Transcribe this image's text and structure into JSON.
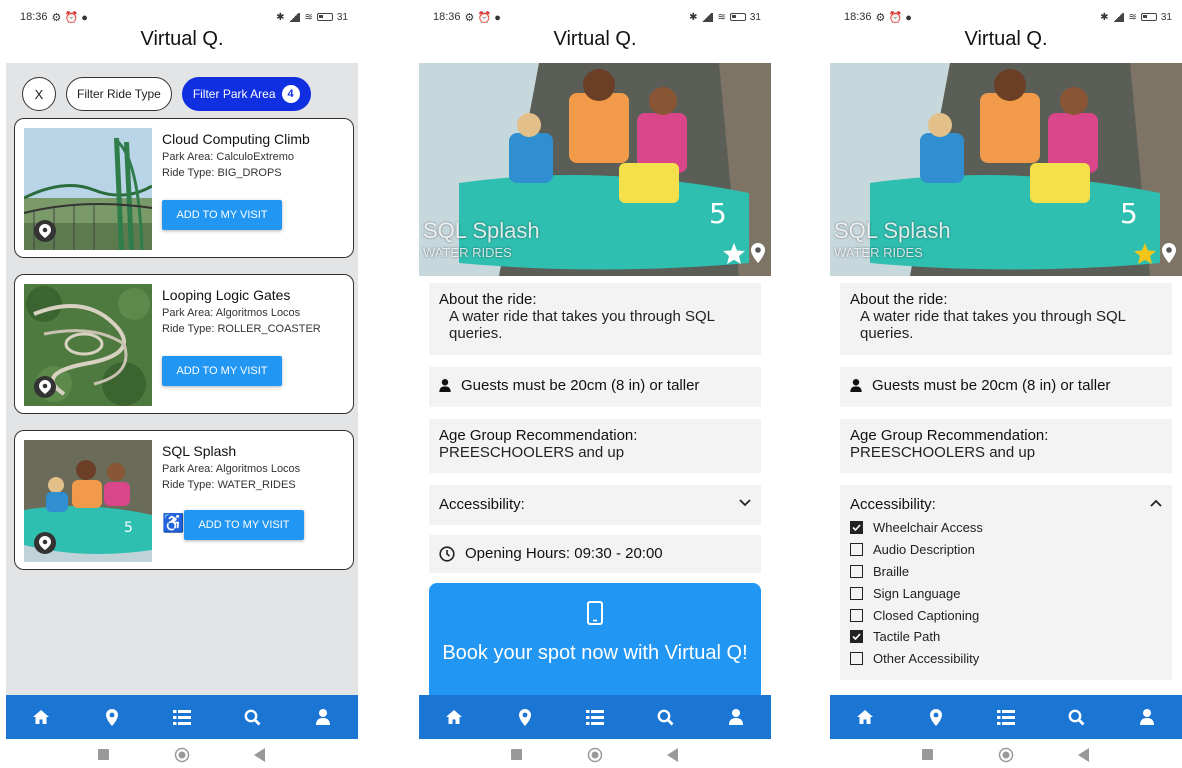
{
  "status": {
    "time": "18:36",
    "battery": "31"
  },
  "app_title": "Virtual Q.",
  "list_screen": {
    "filters": {
      "clear_label": "X",
      "ride_type_label": "Filter Ride Type",
      "park_area_label": "Filter Park Area",
      "park_area_count": "4"
    },
    "rides": [
      {
        "name": "Cloud Computing Climb",
        "park_area": "Park Area: CalculoExtremo",
        "ride_type": "Ride Type: BIG_DROPS",
        "button": "ADD TO MY VISIT",
        "wheelchair": false
      },
      {
        "name": "Looping Logic Gates",
        "park_area": "Park Area: Algoritmos Locos",
        "ride_type": "Ride Type: ROLLER_COASTER",
        "button": "ADD TO MY VISIT",
        "wheelchair": false
      },
      {
        "name": "SQL Splash",
        "park_area": "Park Area: Algoritmos Locos",
        "ride_type": "Ride Type: WATER_RIDES",
        "button": "ADD TO MY VISIT",
        "wheelchair": true
      }
    ]
  },
  "detail": {
    "ride_name": "SQL Splash",
    "ride_category": "WATER RIDES",
    "about_heading": "About the ride:",
    "about_text": "A water ride that takes you through SQL queries.",
    "height_text": "Guests must be 20cm (8 in) or taller",
    "age_heading": "Age Group Recommendation:",
    "age_text": "PREESCHOOLERS and up",
    "accessibility_heading": "Accessibility:",
    "hours_label": "Opening Hours:",
    "hours_value": "09:30 - 20:00",
    "book_text": "Book your spot now with Virtual Q!",
    "favorite_colors": {
      "off": "#ffffff",
      "on": "#f5c518"
    },
    "accessibility_options": [
      {
        "label": "Wheelchair Access",
        "checked": true
      },
      {
        "label": "Audio Description",
        "checked": false
      },
      {
        "label": "Braille",
        "checked": false
      },
      {
        "label": "Sign Language",
        "checked": false
      },
      {
        "label": "Closed Captioning",
        "checked": false
      },
      {
        "label": "Tactile Path",
        "checked": true
      },
      {
        "label": "Other Accessibility",
        "checked": false
      }
    ]
  },
  "bottom_nav": [
    "home-icon",
    "map-pin-icon",
    "list-icon",
    "search-icon",
    "user-icon"
  ],
  "colors": {
    "nav": "#1a76d2",
    "button": "#2196f3",
    "filter_active": "#0f2fe0"
  }
}
